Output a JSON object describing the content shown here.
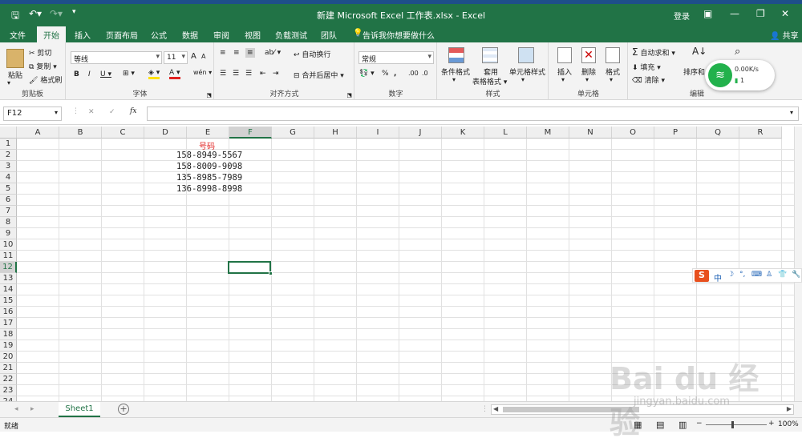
{
  "titlebar": {
    "title": "新建 Microsoft Excel 工作表.xlsx - Excel",
    "login": "登录",
    "share": "共享"
  },
  "tabs": [
    "文件",
    "开始",
    "插入",
    "页面布局",
    "公式",
    "数据",
    "审阅",
    "视图",
    "负载测试",
    "团队"
  ],
  "active_tab": "开始",
  "tell_me": "告诉我你想要做什么",
  "ribbon": {
    "clipboard": {
      "label": "剪贴板",
      "paste": "粘贴",
      "cut": "剪切",
      "copy": "复制",
      "format_painter": "格式刷"
    },
    "font": {
      "label": "字体",
      "name": "等线",
      "size": "11"
    },
    "align": {
      "label": "对齐方式",
      "wrap": "自动换行",
      "merge": "合并后居中"
    },
    "number": {
      "label": "数字",
      "format": "常规"
    },
    "styles": {
      "label": "样式",
      "cond": "条件格式",
      "table1": "套用",
      "table2": "表格格式",
      "cell_style": "单元格样式"
    },
    "cells": {
      "label": "单元格",
      "insert": "插入",
      "delete": "删除",
      "format": "格式"
    },
    "editing": {
      "label": "编辑",
      "autosum": "自动求和",
      "fill": "填充",
      "clear": "清除",
      "sort": "排序和"
    }
  },
  "formula_bar": {
    "name_box": "F12",
    "formula": ""
  },
  "columns": [
    "A",
    "B",
    "C",
    "D",
    "E",
    "F",
    "G",
    "H",
    "I",
    "J",
    "K",
    "L",
    "M",
    "N",
    "O",
    "P",
    "Q",
    "R"
  ],
  "rows": [
    "1",
    "2",
    "3",
    "4",
    "5",
    "6",
    "7",
    "8",
    "9",
    "10",
    "11",
    "12",
    "13",
    "14",
    "15",
    "16",
    "17",
    "18",
    "19",
    "20",
    "21",
    "22",
    "23",
    "24"
  ],
  "cells": {
    "header": "号码",
    "values": [
      "158-8949-5567",
      "158-8009-9098",
      "135-8985-7989",
      "136-8998-8998"
    ]
  },
  "selected_cell": "F12",
  "sheet_tab": "Sheet1",
  "status": {
    "text": "就绪",
    "zoom": "100%"
  },
  "network_widget": {
    "speed": "0.00K/s",
    "count": "1"
  },
  "ime": {
    "mode": "中"
  },
  "watermark": {
    "brand": "Bai du 经验",
    "url": "jingyan.baidu.com"
  },
  "colors": {
    "excel_green": "#217346",
    "header_red": "#e0201f",
    "selected": "#217346"
  }
}
